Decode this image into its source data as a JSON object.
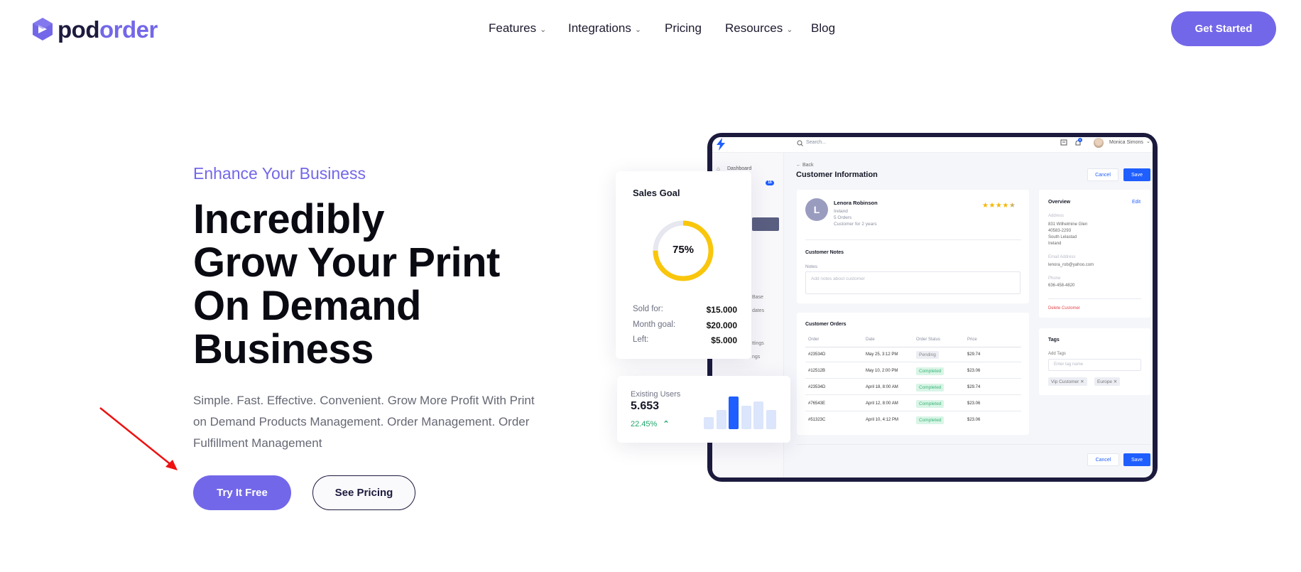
{
  "header": {
    "logo": {
      "part1": "pod",
      "part2": "order"
    },
    "nav": [
      {
        "label": "Features",
        "dropdown": true
      },
      {
        "label": "Integrations",
        "dropdown": true
      },
      {
        "label": "Pricing",
        "dropdown": false
      },
      {
        "label": "Resources",
        "dropdown": true
      },
      {
        "label": "Blog",
        "dropdown": false
      }
    ],
    "cta": "Get Started"
  },
  "hero": {
    "eyebrow": "Enhance Your Business",
    "title_lines": [
      "Incredibly",
      "Grow Your Print",
      "On Demand",
      "Business"
    ],
    "description_lines": [
      "Simple. Fast. Effective. Convenient. Grow More Profit With Print",
      "on Demand Products Management. Order Management. Order",
      "Fulfillment Management"
    ],
    "primary_button": "Try It Free",
    "secondary_button": "See Pricing"
  },
  "colors": {
    "accent": "#7367e9",
    "dark": "#1c1a3d",
    "blue": "#1f5eff",
    "yellow": "#f9c60b",
    "green": "#22a66b",
    "red": "#e5484d"
  },
  "sales_goal": {
    "title": "Sales Goal",
    "percent_label": "75%",
    "percent": 75,
    "rows": [
      {
        "label": "Sold for:",
        "value": "$15.000"
      },
      {
        "label": "Month goal:",
        "value": "$20.000"
      },
      {
        "label": "Left:",
        "value": "$5.000"
      }
    ]
  },
  "existing_users": {
    "label": "Existing Users",
    "value": "5.653",
    "change": "22.45%",
    "bars": [
      0.37,
      0.59,
      1.0,
      0.72,
      0.85,
      0.59
    ],
    "highlight_index": 2
  },
  "app": {
    "search_placeholder": "Search...",
    "notification_count": "6",
    "user_name": "Monica Simons",
    "sidebar": {
      "dashboard": "Dashboard",
      "badge": "16",
      "fragments": [
        "Base",
        "dates",
        "ttings",
        "ngs"
      ]
    },
    "back": "← Back",
    "page_title": "Customer Information",
    "cancel": "Cancel",
    "save": "Save",
    "customer": {
      "initial": "L",
      "name": "Lenora Robinson",
      "country": "Ireland",
      "orders": "5 Orders",
      "tenure": "Customer for 2 years",
      "rating": 4.5,
      "notes_title": "Customer Notes",
      "notes_label": "Notes",
      "notes_placeholder": "Add notes about customer"
    },
    "overview": {
      "title": "Overview",
      "edit": "Edit",
      "address_label": "Address",
      "address_lines": [
        "831 Wilhelmine Glen",
        "40583-2293",
        "South Lelastad",
        "Ireland"
      ],
      "email_label": "Email Address",
      "email": "lenora_rob@yahoo.com",
      "phone_label": "Phone",
      "phone": "636-458-4820",
      "delete": "Delete Customer"
    },
    "orders": {
      "title": "Customer Orders",
      "columns": [
        "Order",
        "Date",
        "Order Status",
        "Price"
      ],
      "rows": [
        {
          "order": "#23534D",
          "date": "May 25, 3:12 PM",
          "status": "Pending",
          "price": "$29.74"
        },
        {
          "order": "#12512B",
          "date": "May 10, 2:00 PM",
          "status": "Completed",
          "price": "$23.06"
        },
        {
          "order": "#23534D",
          "date": "April 18, 8:00 AM",
          "status": "Completed",
          "price": "$29.74"
        },
        {
          "order": "#76543E",
          "date": "April 12, 8:00 AM",
          "status": "Completed",
          "price": "$23.06"
        },
        {
          "order": "#51323C",
          "date": "April 10, 4:12 PM",
          "status": "Completed",
          "price": "$23.06"
        }
      ]
    },
    "tags": {
      "title": "Tags",
      "label": "Add Tags",
      "placeholder": "Enter tag name",
      "items": [
        "Vip Customer",
        "Europe"
      ]
    }
  }
}
